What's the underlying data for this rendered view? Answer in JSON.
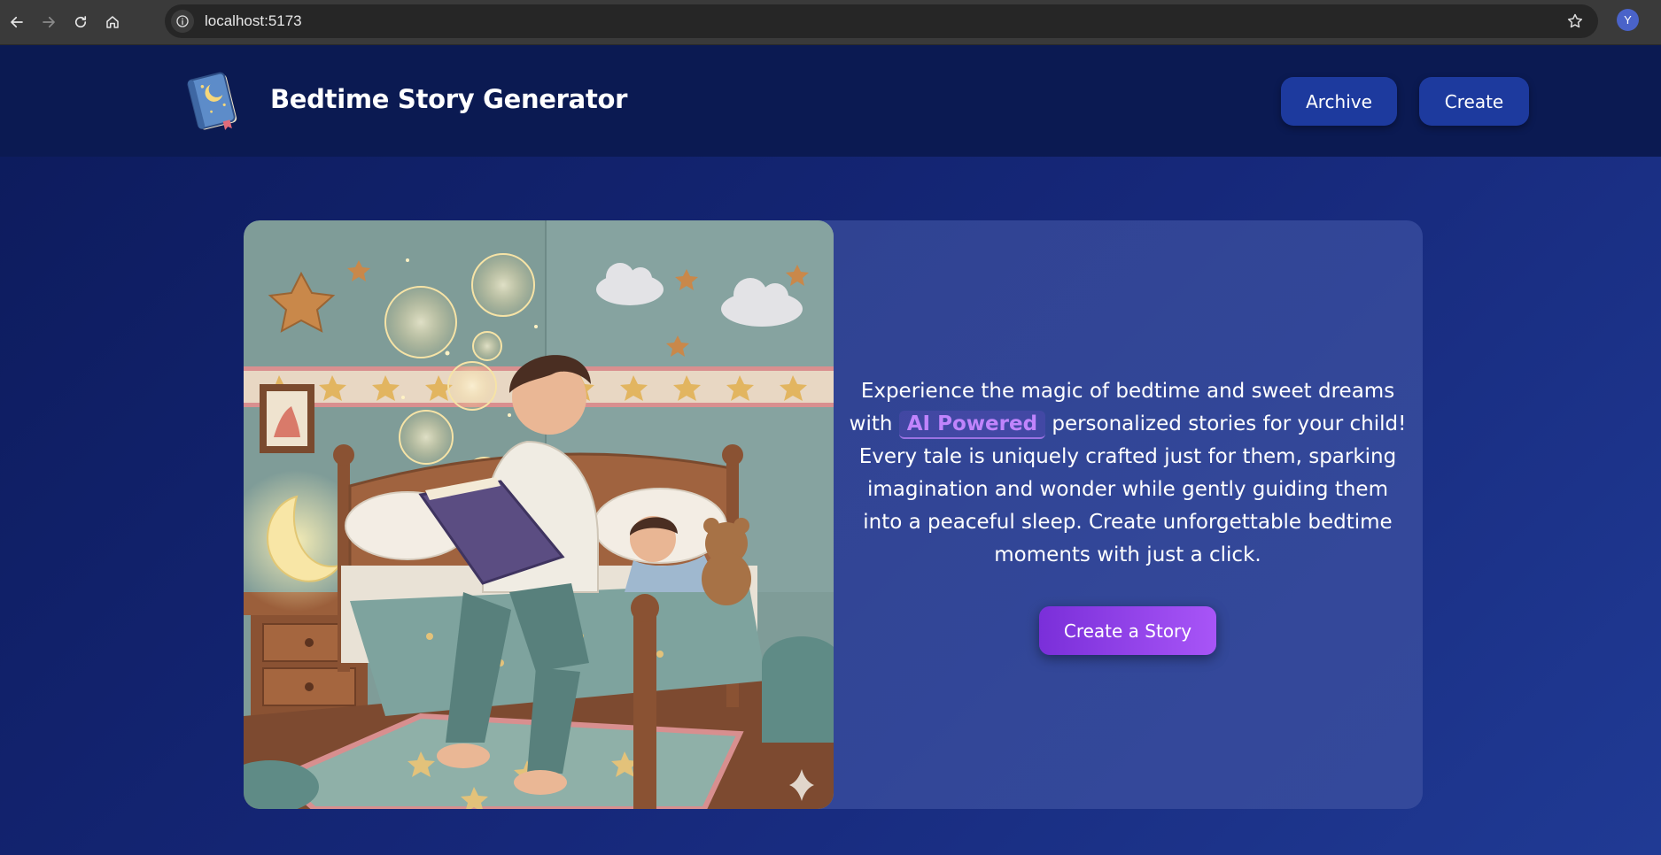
{
  "browser": {
    "url": "localhost:5173",
    "profile_initial": "Y"
  },
  "header": {
    "title": "Bedtime Story Generator",
    "nav": {
      "archive_label": "Archive",
      "create_label": "Create"
    }
  },
  "hero": {
    "text_before": "Experience the magic of bedtime and sweet dreams with",
    "highlight": "AI Powered",
    "text_after": "personalized stories for your child! Every tale is uniquely crafted just for them, sparking imagination and wonder while gently guiding them into a peaceful sleep. Create unforgettable bedtime moments with just a click.",
    "cta_label": "Create a Story"
  },
  "colors": {
    "page_bg": "#16287a",
    "header_bg": "#0b1a52",
    "nav_button_bg": "#1d3a9e",
    "accent_purple": "#a855f7",
    "highlight_text": "#c084fc"
  },
  "icons": {
    "back": "arrow-left-icon",
    "forward": "arrow-right-icon",
    "reload": "reload-icon",
    "home": "home-icon",
    "site_info": "info-icon",
    "bookmark": "star-outline-icon",
    "logo": "storybook-icon",
    "illustration": "father-reading-bedtime-story-illustration"
  }
}
